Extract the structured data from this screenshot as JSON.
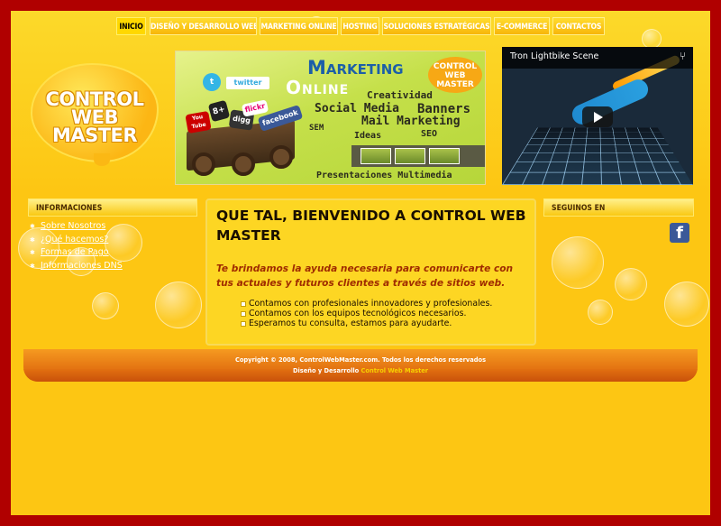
{
  "nav": {
    "items": [
      {
        "label": "INICIO",
        "active": true
      },
      {
        "label": "DISEÑO Y DESARROLLO WEB",
        "active": false
      },
      {
        "label": "MARKETING ONLINE",
        "active": false
      },
      {
        "label": "HOSTING",
        "active": false
      },
      {
        "label": "SOLUCIONES ESTRATÉGICAS",
        "active": false
      },
      {
        "label": "E-COMMERCE",
        "active": false
      },
      {
        "label": "CONTACTOS",
        "active": false
      }
    ]
  },
  "logo": {
    "line1": "CONTROL",
    "line2": "WEB",
    "line3": "MASTER"
  },
  "banner": {
    "title1": "Marketing",
    "title2": "Online",
    "words": [
      "Creatividad",
      "Social Media",
      "Banners",
      "SEM",
      "Mail Marketing",
      "Ideas",
      "SEO",
      "Presentaciones Multimedia"
    ],
    "badge": "CONTROL WEB MASTER",
    "social_tags": [
      "twitter",
      "facebook",
      "8+",
      "digg",
      "You Tube",
      "flickr"
    ]
  },
  "video": {
    "title": "Tron Lightbike Scene"
  },
  "sidebar_left": {
    "heading": "INFORMACIONES",
    "links": [
      "Sobre Nosotros",
      "¿Qué hacemos?",
      "Formas de Pago",
      "Informaciones DNS"
    ]
  },
  "sidebar_right": {
    "heading": "SEGUINOS EN",
    "social": "facebook-icon"
  },
  "main": {
    "heading": "QUE TAL, BIENVENIDO A CONTROL WEB MASTER",
    "intro": "Te brindamos la ayuda necesaria para comunicarte con tus actuales y futuros clientes a través de sitios web.",
    "bullets": [
      "Contamos con profesionales innovadores y profesionales.",
      "Contamos con los equipos tecnológicos necesarios.",
      "Esperamos tu consulta, estamos para ayudarte."
    ]
  },
  "footer": {
    "copyright": "Copyright © 2008, ControlWebMaster.com. Todos los derechos reservados",
    "design_label": "Diseño y Desarrollo",
    "design_link": "Control Web Master"
  },
  "colors": {
    "border": "#b00000",
    "background": "#fdc613",
    "footer": "#e06a10",
    "link": "#ffffff",
    "intro_text": "#a02c00"
  }
}
